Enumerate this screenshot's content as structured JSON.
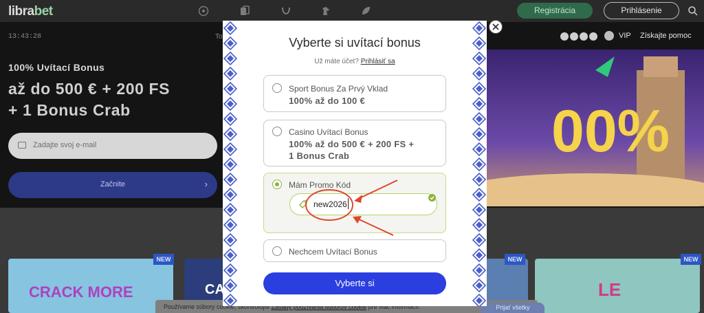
{
  "header": {
    "logo_main": "libra",
    "logo_accent": "bet",
    "nav_icons": [
      "soccer-ball-icon",
      "cards-icon",
      "horseshoe-icon",
      "horse-icon",
      "rocket-icon"
    ],
    "register_label": "Registrácia",
    "login_label": "Prihlásenie",
    "search_icon": "search-icon"
  },
  "hero": {
    "clock": "13:43:28",
    "to_text": "To",
    "bonus_line1": "100% Uvítací Bonus",
    "bonus_line2": "až do 500 € + 200 FS",
    "bonus_line3": "+ 1 Bonus Crab",
    "email_placeholder": "Zadajte svoj e-mail",
    "start_label": "Začnite"
  },
  "right_strip": {
    "vip": "VIP",
    "help": "Získajte pomoc",
    "banner_text": "00%"
  },
  "tiles": {
    "new_badge": "NEW",
    "tile1_text": "CRACK MORE",
    "tile2_text": "CA",
    "tile3_text": "LE"
  },
  "cookie": {
    "text_before": "Používame súbory cookie, skontrolujte ",
    "link": "Zásady používania súborov cookie",
    "text_after": " pre viac informácií.",
    "button": "Prijať všetky"
  },
  "modal": {
    "title": "Vyberte si uvítací bonus",
    "account_question": "Už máte účet?",
    "login_link": "Prihlásiť sa",
    "options": [
      {
        "title": "Sport Bonus Za Prvý Vklad",
        "subtitle": "100% až do 100 €"
      },
      {
        "title": "Casino Uvítací Bonus",
        "subtitle_line1": "100% až do 500 € + 200 FS +",
        "subtitle_line2": "1 Bonus Crab"
      },
      {
        "title": "Mám Promo Kód",
        "promo_value": "new2026"
      },
      {
        "title": "Nechcem Uvítací Bonus"
      }
    ],
    "submit_label": "Vyberte si"
  },
  "colors": {
    "accent_blue": "#2b3fe0",
    "promo_green": "#8fb33e",
    "annotation_red": "#e0462c"
  }
}
